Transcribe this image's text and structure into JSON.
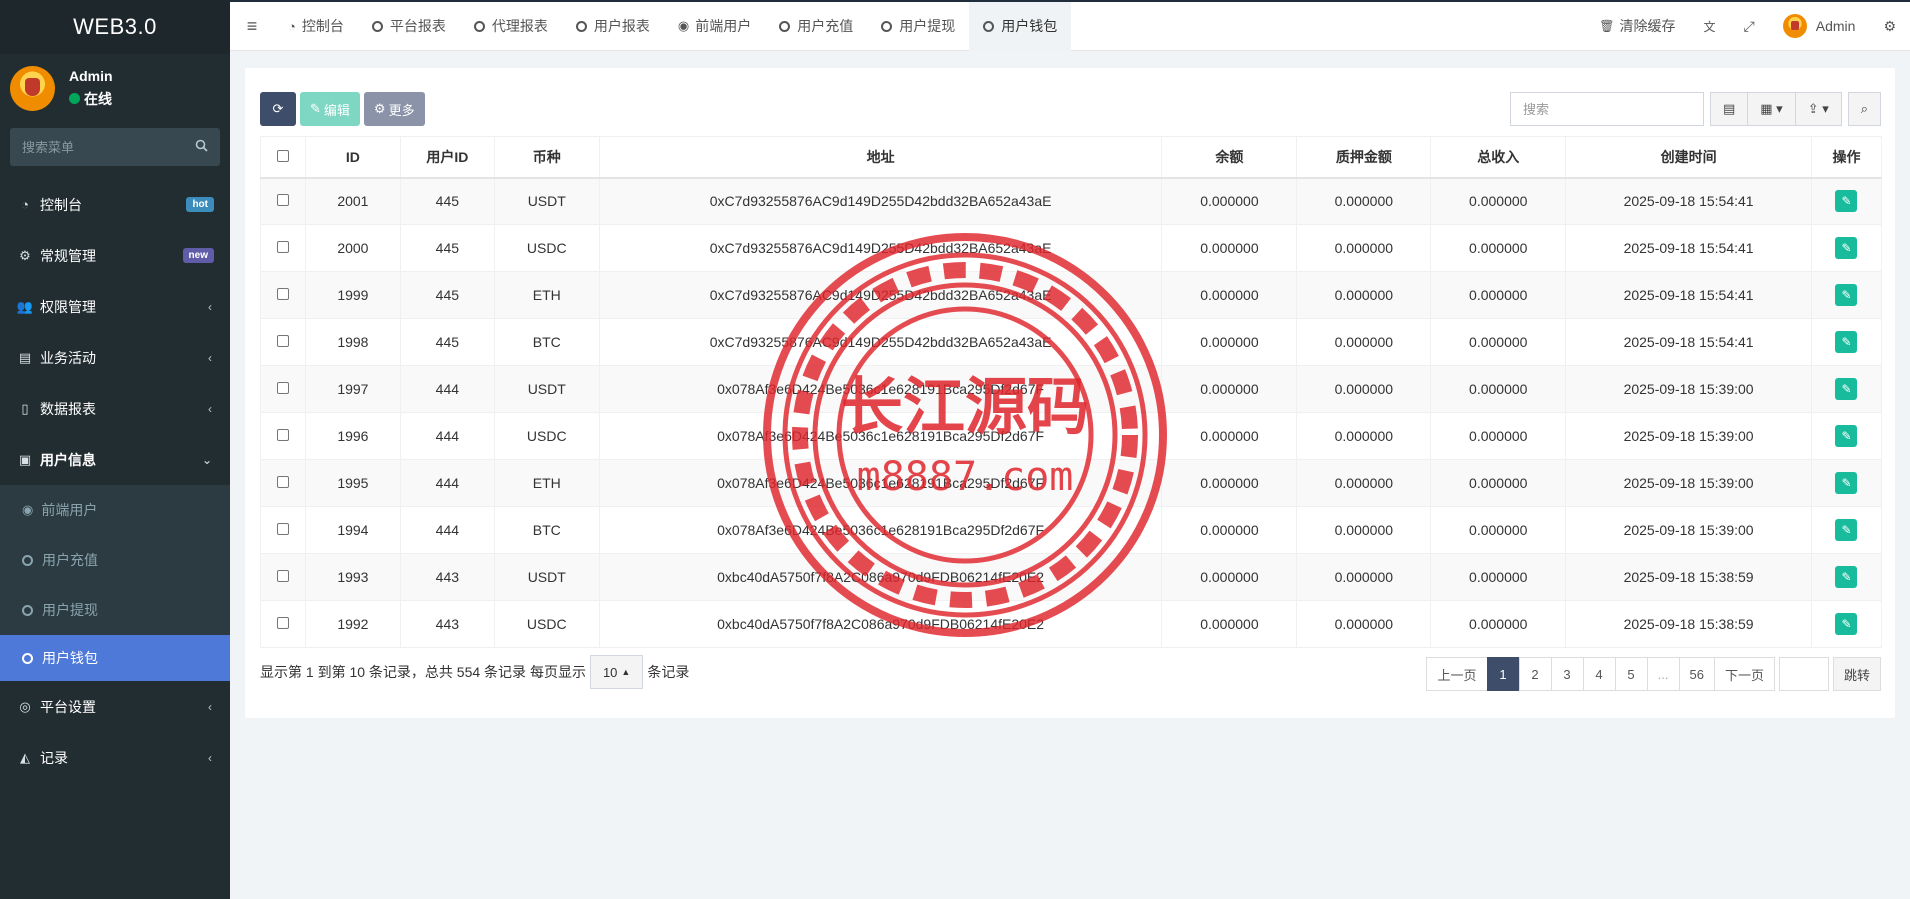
{
  "app": {
    "title": "WEB3.0"
  },
  "user": {
    "name": "Admin",
    "status": "在线"
  },
  "sidebar": {
    "search_placeholder": "搜索菜单",
    "items": [
      {
        "label": "控制台",
        "icon": "dashboard-icon",
        "badge": "hot"
      },
      {
        "label": "常规管理",
        "icon": "cogs-icon",
        "badge": "new"
      },
      {
        "label": "权限管理",
        "icon": "users-icon"
      },
      {
        "label": "业务活动",
        "icon": "id-card-icon"
      },
      {
        "label": "数据报表",
        "icon": "file-icon"
      },
      {
        "label": "用户信息",
        "icon": "user-box-icon"
      }
    ],
    "sub_items": [
      {
        "label": "前端用户"
      },
      {
        "label": "用户充值"
      },
      {
        "label": "用户提现"
      },
      {
        "label": "用户钱包"
      }
    ],
    "bottom_items": [
      {
        "label": "平台设置",
        "icon": "dot-circle-icon"
      },
      {
        "label": "记录",
        "icon": "area-chart-icon"
      }
    ]
  },
  "topnav": {
    "tabs": [
      {
        "label": "控制台"
      },
      {
        "label": "平台报表"
      },
      {
        "label": "代理报表"
      },
      {
        "label": "用户报表"
      },
      {
        "label": "前端用户"
      },
      {
        "label": "用户充值"
      },
      {
        "label": "用户提现"
      },
      {
        "label": "用户钱包"
      }
    ],
    "clear_cache": "清除缓存",
    "admin_name": "Admin"
  },
  "toolbar": {
    "edit_label": "编辑",
    "more_label": "更多",
    "search_placeholder": "搜索"
  },
  "table": {
    "headers": [
      "ID",
      "用户ID",
      "币种",
      "地址",
      "余额",
      "质押金额",
      "总收入",
      "创建时间",
      "操作"
    ],
    "rows": [
      {
        "id": "2001",
        "uid": "445",
        "coin": "USDT",
        "address": "0xC7d93255876AC9d149D255D42bdd32BA652a43aE",
        "balance": "0.000000",
        "pledge": "0.000000",
        "income": "0.000000",
        "created": "2025-09-18 15:54:41"
      },
      {
        "id": "2000",
        "uid": "445",
        "coin": "USDC",
        "address": "0xC7d93255876AC9d149D255D42bdd32BA652a43aE",
        "balance": "0.000000",
        "pledge": "0.000000",
        "income": "0.000000",
        "created": "2025-09-18 15:54:41"
      },
      {
        "id": "1999",
        "uid": "445",
        "coin": "ETH",
        "address": "0xC7d93255876AC9d149D255D42bdd32BA652a43aE",
        "balance": "0.000000",
        "pledge": "0.000000",
        "income": "0.000000",
        "created": "2025-09-18 15:54:41"
      },
      {
        "id": "1998",
        "uid": "445",
        "coin": "BTC",
        "address": "0xC7d93255876AC9d149D255D42bdd32BA652a43aE",
        "balance": "0.000000",
        "pledge": "0.000000",
        "income": "0.000000",
        "created": "2025-09-18 15:54:41"
      },
      {
        "id": "1997",
        "uid": "444",
        "coin": "USDT",
        "address": "0x078Af3e6D424Be5036c1e628191Bca295Df2d67F",
        "balance": "0.000000",
        "pledge": "0.000000",
        "income": "0.000000",
        "created": "2025-09-18 15:39:00"
      },
      {
        "id": "1996",
        "uid": "444",
        "coin": "USDC",
        "address": "0x078Af3e6D424Be5036c1e628191Bca295Df2d67F",
        "balance": "0.000000",
        "pledge": "0.000000",
        "income": "0.000000",
        "created": "2025-09-18 15:39:00"
      },
      {
        "id": "1995",
        "uid": "444",
        "coin": "ETH",
        "address": "0x078Af3e6D424Be5036c1e628191Bca295Df2d67F",
        "balance": "0.000000",
        "pledge": "0.000000",
        "income": "0.000000",
        "created": "2025-09-18 15:39:00"
      },
      {
        "id": "1994",
        "uid": "444",
        "coin": "BTC",
        "address": "0x078Af3e6D424Be5036c1e628191Bca295Df2d67F",
        "balance": "0.000000",
        "pledge": "0.000000",
        "income": "0.000000",
        "created": "2025-09-18 15:39:00"
      },
      {
        "id": "1993",
        "uid": "443",
        "coin": "USDT",
        "address": "0xbc40dA5750f7f8A2C086a970d9FDB06214fE20E2",
        "balance": "0.000000",
        "pledge": "0.000000",
        "income": "0.000000",
        "created": "2025-09-18 15:38:59"
      },
      {
        "id": "1992",
        "uid": "443",
        "coin": "USDC",
        "address": "0xbc40dA5750f7f8A2C086a970d9FDB06214fE20E2",
        "balance": "0.000000",
        "pledge": "0.000000",
        "income": "0.000000",
        "created": "2025-09-18 15:38:59"
      }
    ]
  },
  "summary": {
    "text": "显示第 1 到第 10 条记录，总共 554 条记录 每页显示",
    "page_size": "10",
    "suffix": "条记录"
  },
  "pager": {
    "prev": "上一页",
    "pages": [
      "1",
      "2",
      "3",
      "4",
      "5",
      "...",
      "56"
    ],
    "next": "下一页",
    "jump": "跳转"
  },
  "watermark": {
    "text": "长江源码",
    "url": "m8887.com"
  },
  "colors": {
    "sidebar_bg": "#222d32",
    "active_menu": "#4e79d9",
    "edit_green": "#18bc9c",
    "stamp_red": "#e0252b"
  }
}
